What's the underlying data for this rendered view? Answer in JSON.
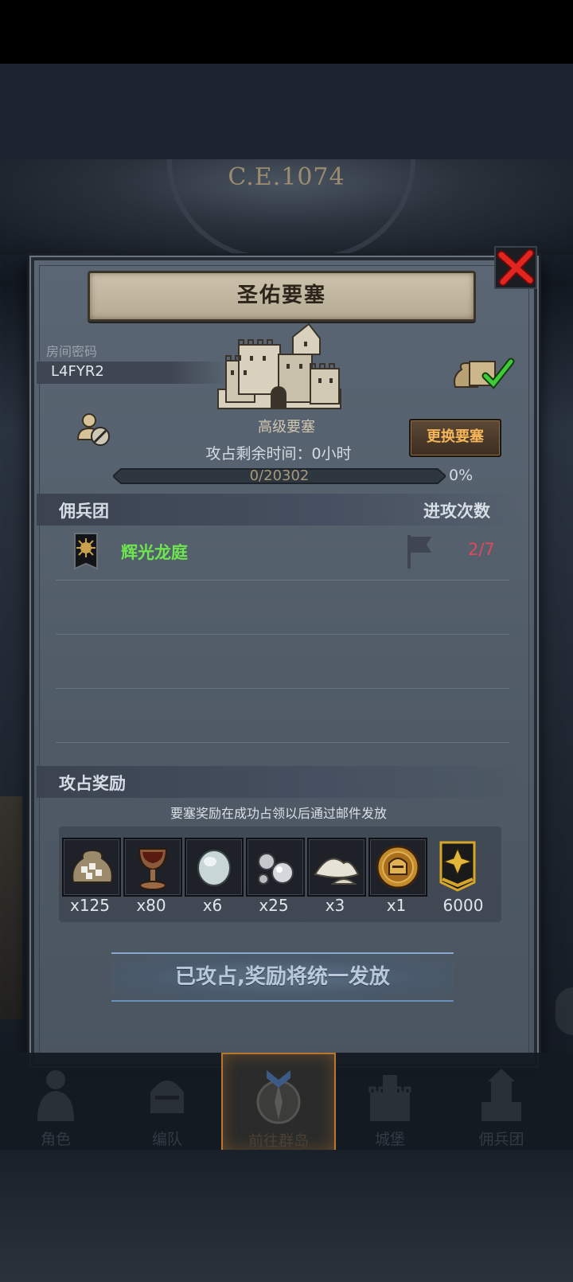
{
  "background": {
    "era_label": "C.E.1074"
  },
  "dialog": {
    "title": "圣佑要塞",
    "room_code_label": "房间密码",
    "room_code": "L4FYR2",
    "fortress_name": "高级要塞",
    "change_button": "更换要塞",
    "timer_label": "攻占剩余时间：",
    "timer_value": "0小时",
    "progress_text": "0/20302",
    "progress_percent": "0%",
    "progress_fraction": 0
  },
  "mercenary_section": {
    "left_header": "佣兵团",
    "right_header": "进攻次数",
    "rows": [
      {
        "guild_name": "辉光龙庭",
        "attack_count": "2/7"
      }
    ]
  },
  "rewards_section": {
    "header": "攻占奖励",
    "note": "要塞奖励在成功占领以后通过邮件发放",
    "items": [
      {
        "icon": "wheat-sack-icon",
        "qty": "x125"
      },
      {
        "icon": "goblet-icon",
        "qty": "x80"
      },
      {
        "icon": "moonstone-icon",
        "qty": "x6"
      },
      {
        "icon": "silver-ore-icon",
        "qty": "x25"
      },
      {
        "icon": "salt-pile-icon",
        "qty": "x3"
      },
      {
        "icon": "knight-coin-icon",
        "qty": "x1"
      },
      {
        "icon": "honor-badge-icon",
        "qty": "6000"
      }
    ]
  },
  "status_banner": "已攻占,奖励将统一发放",
  "nav": {
    "items": [
      {
        "label": "角色"
      },
      {
        "label": "编队"
      },
      {
        "label": "前往群岛"
      },
      {
        "label": "城堡"
      },
      {
        "label": "佣兵团"
      }
    ]
  },
  "colors": {
    "guild_name": "#6ee64f",
    "attack_count": "#e0495a",
    "change_button_text": "#f5b65a",
    "nav_active_border": "#b8762e"
  }
}
